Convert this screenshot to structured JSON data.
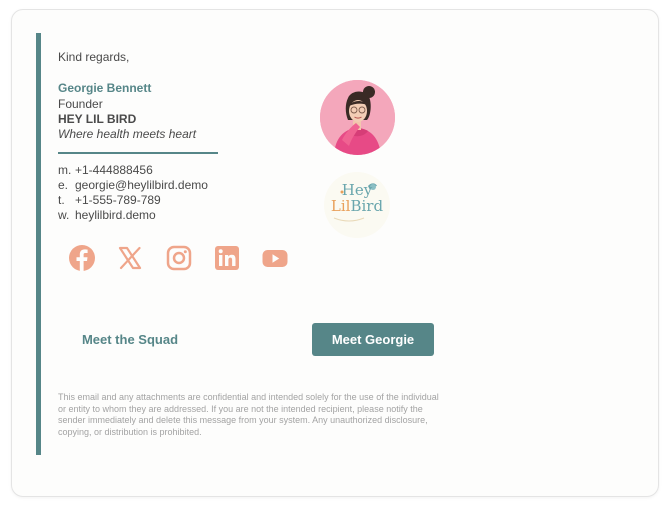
{
  "signature": {
    "greeting": "Kind regards,",
    "name": "Georgie Bennett",
    "role": "Founder",
    "company": "HEY LIL BIRD",
    "tagline": "Where health meets heart"
  },
  "contact": [
    {
      "key": "m.",
      "value": "+1-444888456"
    },
    {
      "key": "e.",
      "value": "georgie@heylilbird.demo"
    },
    {
      "key": "t.",
      "value": "+1-555-789-789"
    },
    {
      "key": "w.",
      "value": "heylilbird.demo"
    }
  ],
  "socials": [
    "facebook-icon",
    "x-icon",
    "instagram-icon",
    "linkedin-icon",
    "youtube-icon"
  ],
  "logo": {
    "line1": "Hey",
    "line2a": "Lil",
    "line2b": "Bird"
  },
  "buttons": {
    "squad": "Meet the Squad",
    "georgie": "Meet Georgie"
  },
  "disclaimer": "This email and any attachments are confidential and intended solely for the use of the individual or entity to whom they are addressed. If you are not the intended recipient, please notify the sender immediately and delete this message from your system. Any unauthorized disclosure, copying, or distribution is prohibited.",
  "colors": {
    "accent": "#568688",
    "social": "#efa58a",
    "avatar_bg": "#f4a7bb"
  }
}
